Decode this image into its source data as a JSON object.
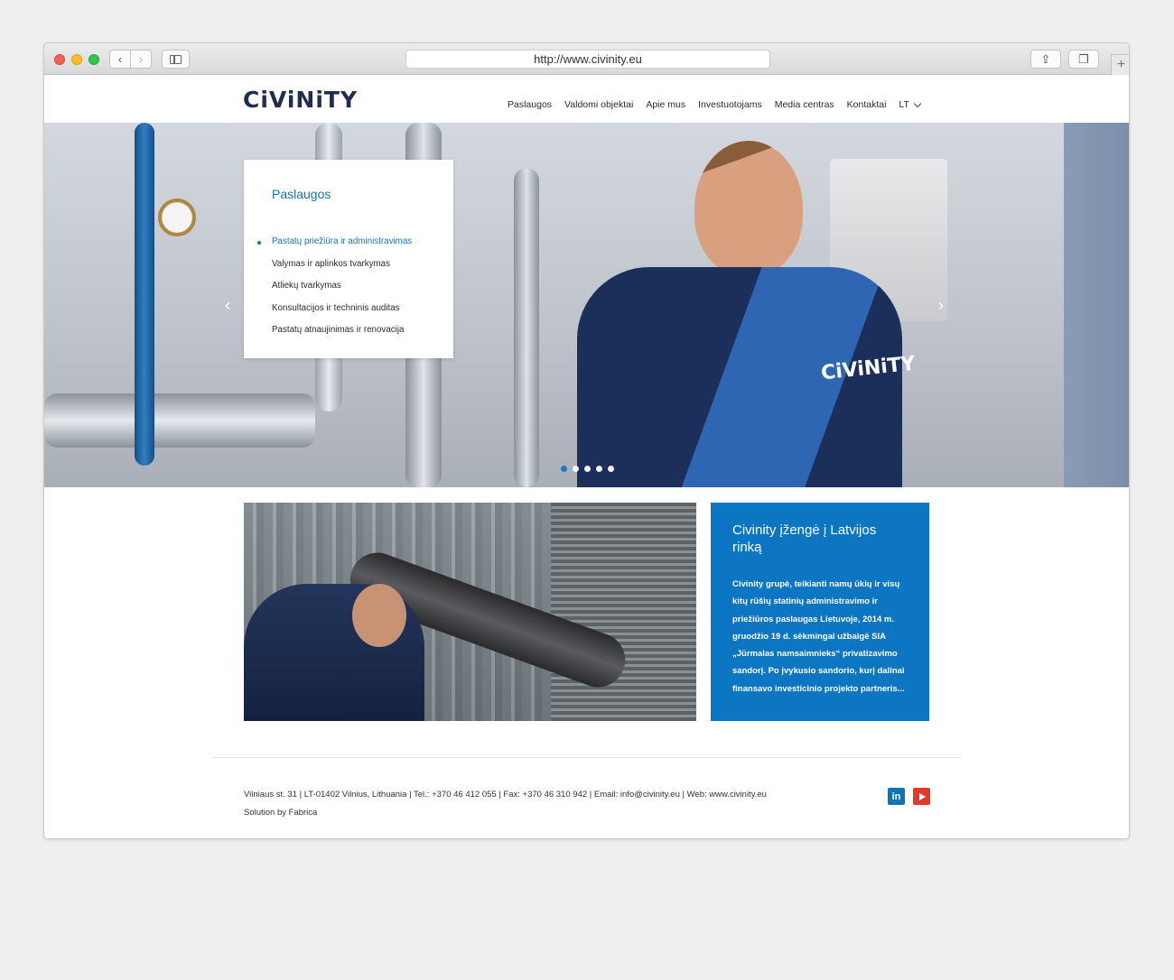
{
  "browser": {
    "url": "http://www.civinity.eu"
  },
  "header": {
    "logo": "CiViNiTY",
    "nav": [
      "Paslaugos",
      "Valdomi objektai",
      "Apie mus",
      "Investuotojams",
      "Media centras",
      "Kontaktai"
    ],
    "language": "LT"
  },
  "hero": {
    "card_title": "Paslaugos",
    "services": [
      "Pastatų priežiūra ir administravimas",
      "Valymas ir aplinkos tvarkymas",
      "Atliekų tvarkymas",
      "Konsultacijos ir techninis auditas",
      "Pastatų atnaujinimas ir renovacija"
    ],
    "active_service_index": 0,
    "worker_jacket_logo": "CiViNiTY",
    "slide_count": 5,
    "active_slide_index": 0
  },
  "news": {
    "title": "Civinity įžengė į Latvijos rinką",
    "body": "Civinity grupė, teikianti namų ūkių ir visų kitų rūšių statinių administravimo ir priežiūros paslaugas Lietuvoje, 2014 m. gruodžio 19 d. sėkmingai užbaigė SIA „Jūrmalas namsaimnieks“ privatizavimo sandorį. Po įvykusio sandorio, kurį dalinai finansavo investicinio projekto partneris..."
  },
  "footer": {
    "contact_line": "Vilniaus st. 31 | LT-01402 Vilnius, Lithuania | Tel.: +370 46 412 055 | Fax: +370 46 310 942 | Email: info@civinity.eu | Web: www.civinity.eu",
    "credit_line": "Solution by Fabrica",
    "social": [
      "in",
      "youtube"
    ]
  },
  "colors": {
    "brand_blue": "#0d76c3",
    "link_blue": "#1b71b8",
    "logo_navy": "#1f2d4e",
    "youtube_red": "#e03b26",
    "linkedin_blue": "#1275b3"
  }
}
